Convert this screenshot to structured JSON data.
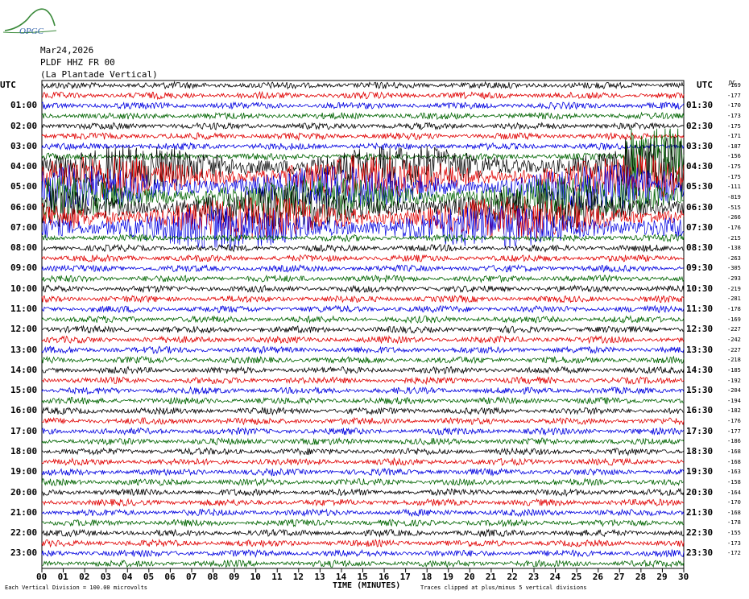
{
  "header": {
    "logo_text": "OPGC",
    "date": "Mar24,2026",
    "station": "PLDF HHZ FR 00",
    "location": "(La Plantade Vertical)",
    "utc_left": "UTC",
    "utc_right": "UTC",
    "dc_label": "DC"
  },
  "footer": {
    "xlabel": "TIME (MINUTES)",
    "scale_note": "Each Vertical Division =  100.00 microvolts",
    "clip_note": "Traces clipped at plus/minus 5 vertical divisions"
  },
  "chart_data": {
    "type": "line",
    "subtype": "helicorder",
    "x_ticks": [
      "00",
      "01",
      "02",
      "03",
      "04",
      "05",
      "06",
      "07",
      "08",
      "09",
      "10",
      "11",
      "12",
      "13",
      "14",
      "15",
      "16",
      "17",
      "18",
      "19",
      "20",
      "21",
      "22",
      "23",
      "24",
      "25",
      "26",
      "27",
      "28",
      "29",
      "30"
    ],
    "xlim": [
      0,
      30
    ],
    "left_hour_labels": [
      "01:00",
      "02:00",
      "03:00",
      "04:00",
      "05:00",
      "06:00",
      "07:00",
      "08:00",
      "09:00",
      "10:00",
      "11:00",
      "12:00",
      "13:00",
      "14:00",
      "15:00",
      "16:00",
      "17:00",
      "18:00",
      "19:00",
      "20:00",
      "21:00",
      "22:00",
      "23:00"
    ],
    "right_hour_labels": [
      "01:30",
      "02:30",
      "03:30",
      "04:30",
      "05:30",
      "06:30",
      "07:30",
      "08:30",
      "09:30",
      "10:30",
      "11:30",
      "12:30",
      "13:30",
      "14:30",
      "15:30",
      "16:30",
      "17:30",
      "18:30",
      "19:30",
      "20:30",
      "21:30",
      "22:30",
      "23:30"
    ],
    "trace_colors": [
      "#000000",
      "#e00000",
      "#0000e0",
      "#006400"
    ],
    "trace_count": 48,
    "trace_duration_minutes": 30,
    "dc_offsets": [
      "-169",
      "-177",
      "-170",
      "-173",
      "-175",
      "-171",
      "-187",
      "-156",
      "-175",
      "-175",
      "-111",
      "-819",
      "-515",
      "-266",
      "-176",
      "-215",
      "-138",
      "-263",
      "-305",
      "-293",
      "-219",
      "-281",
      "-178",
      "-169",
      "-227",
      "-242",
      "-227",
      "-218",
      "-185",
      "-192",
      "-204",
      "-194",
      "-182",
      "-176",
      "-177",
      "-186",
      "-168",
      "-168",
      "-163",
      "-158",
      "-164",
      "-170",
      "-168",
      "-178",
      "-155",
      "-173",
      "-172"
    ],
    "scale_microvolts_per_division": 100.0,
    "clip_divisions": 5,
    "event_trace_window": [
      8,
      14
    ]
  }
}
